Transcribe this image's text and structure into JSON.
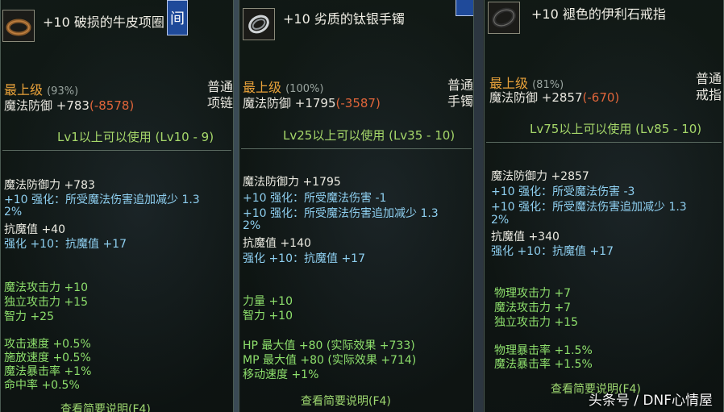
{
  "panels": [
    {
      "title": "+10 破损的牛皮项圈",
      "corner": "间",
      "grade": "最上级",
      "grade_pct": "(93%)",
      "type_line1": "普通",
      "type_line2": "项链",
      "defense_label": "魔法防御 +783",
      "defense_diff": "(-8578)",
      "requirement": "Lv1以上可以使用 (Lv10 - 9)",
      "lines": [
        {
          "text": "魔法防御力 +783",
          "color": "white"
        },
        {
          "text": "+10 强化：所受魔法伤害追加减少 1.3",
          "color": "cyan"
        },
        {
          "text": "2%",
          "color": "cyan"
        },
        {
          "text": "抗魔值 +40",
          "color": "white"
        },
        {
          "text": "强化 +10：抗魔值 +17",
          "color": "cyan"
        },
        {
          "text": "魔法攻击力 +10",
          "color": "green"
        },
        {
          "text": "独立攻击力 +15",
          "color": "green"
        },
        {
          "text": "智力 +25",
          "color": "green"
        },
        {
          "text": "攻击速度 +0.5%",
          "color": "green"
        },
        {
          "text": "施放速度 +0.5%",
          "color": "green"
        },
        {
          "text": "魔法暴击率 +1%",
          "color": "green"
        },
        {
          "text": "命中率 +0.5%",
          "color": "green"
        }
      ],
      "footer": "查看简要说明(F4)"
    },
    {
      "title": "+10 劣质的钛银手镯",
      "corner": "",
      "grade": "最上级",
      "grade_pct": "(100%)",
      "type_line1": "普通",
      "type_line2": "手镯",
      "defense_label": "魔法防御 +1795",
      "defense_diff": "(-3587)",
      "requirement": "Lv25以上可以使用 (Lv35 - 10)",
      "lines": [
        {
          "text": "魔法防御力 +1795",
          "color": "white"
        },
        {
          "text": "+10 强化：所受魔法伤害 -1",
          "color": "cyan"
        },
        {
          "text": "+10 强化：所受魔法伤害追加减少 1.3",
          "color": "cyan"
        },
        {
          "text": "2%",
          "color": "cyan"
        },
        {
          "text": "抗魔值 +140",
          "color": "white"
        },
        {
          "text": "强化 +10：抗魔值 +17",
          "color": "cyan"
        },
        {
          "text": "力量 +10",
          "color": "green"
        },
        {
          "text": "智力 +10",
          "color": "green"
        },
        {
          "text": "HP 最大值 +80 (实际效果 +733)",
          "color": "green"
        },
        {
          "text": "MP 最大值 +80 (实际效果 +714)",
          "color": "green"
        },
        {
          "text": "移动速度 +1%",
          "color": "green"
        }
      ],
      "footer": "查看简要说明(F4)"
    },
    {
      "title": "+10 褪色的伊利石戒指",
      "corner": "",
      "grade": "最上级",
      "grade_pct": "(81%)",
      "type_line1": "普通",
      "type_line2": "戒指",
      "defense_label": "魔法防御 +2857",
      "defense_diff": "(-670)",
      "requirement": "Lv75以上可以使用 (Lv85 - 10)",
      "lines": [
        {
          "text": "魔法防御力 +2857",
          "color": "white"
        },
        {
          "text": "+10 强化：所受魔法伤害 -3",
          "color": "cyan"
        },
        {
          "text": "+10 强化：所受魔法伤害追加减少 1.3",
          "color": "cyan"
        },
        {
          "text": "2%",
          "color": "cyan"
        },
        {
          "text": "抗魔值 +340",
          "color": "white"
        },
        {
          "text": "强化 +10：抗魔值 +17",
          "color": "cyan"
        },
        {
          "text": "物理攻击力 +7",
          "color": "green"
        },
        {
          "text": "魔法攻击力 +7",
          "color": "green"
        },
        {
          "text": "独立攻击力 +15",
          "color": "green"
        },
        {
          "text": "物理暴击率 +1.5%",
          "color": "green"
        },
        {
          "text": "魔法暴击率 +1.5%",
          "color": "green"
        }
      ],
      "footer": "查看简要说明(F4)"
    }
  ],
  "watermark": "头条号 / DNF心情屋",
  "colors": {
    "grade": "#e8a13a",
    "negative": "#e0653a",
    "requirement": "#a6d86a",
    "cyan": "#8ecff0",
    "green": "#8ee06c"
  },
  "icons": [
    "necklace-icon",
    "bracelet-icon",
    "ring-icon"
  ]
}
